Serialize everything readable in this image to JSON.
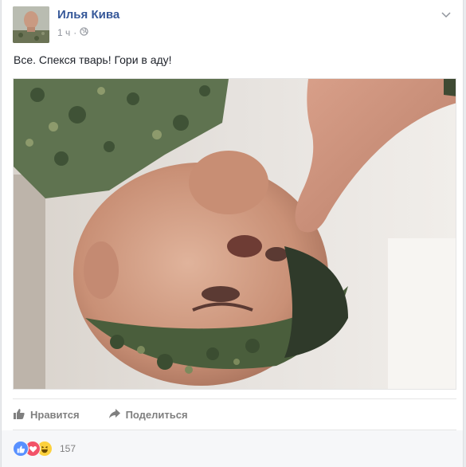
{
  "post": {
    "author": "Илья Кива",
    "time": "1 ч",
    "separator": "·",
    "text": "Все. Спекся тварь! Гори в аду!"
  },
  "actions": {
    "like_label": "Нравится",
    "share_label": "Поделиться"
  },
  "reactions": {
    "icons": [
      "like-reaction-icon",
      "love-reaction-icon",
      "haha-reaction-icon"
    ],
    "count": "157"
  },
  "colors": {
    "author": "#365899",
    "secondary": "#90949c",
    "like_blue": "#5890ff",
    "love_red": "#f25268",
    "haha_yellow": "#fcd13d"
  }
}
